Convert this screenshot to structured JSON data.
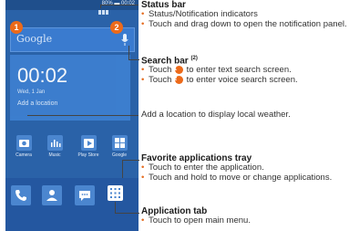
{
  "phone": {
    "status_text": "80% ▬ 00:02",
    "search_logo": "Google",
    "badge_1": "1",
    "badge_2": "2",
    "clock_time": "00:02",
    "clock_date": "Wed, 1 Jan",
    "clock_location": "Add a location",
    "apps": [
      "Camera",
      "Music",
      "Play Store",
      "Google"
    ],
    "tray_icons": [
      "phone-icon",
      "contacts-icon",
      "messaging-icon"
    ]
  },
  "annotations": {
    "status_bar": {
      "heading": "Status bar",
      "bullets": [
        "Status/Notification indicators",
        "Touch and drag down to open the notification panel."
      ]
    },
    "search_bar": {
      "heading": "Search bar",
      "superscript": "(2)",
      "bullet_1_pre": "Touch",
      "bullet_1_post": "to enter text search screen.",
      "bullet_2_pre": "Touch",
      "bullet_2_post": "to enter voice search screen."
    },
    "weather": {
      "text": "Add a location to display local weather."
    },
    "favorites": {
      "heading": "Favorite applications tray",
      "bullets": [
        "Touch to enter the application.",
        "Touch and hold to move or change applications."
      ]
    },
    "app_tab": {
      "heading": "Application tab",
      "bullets": [
        "Touch to open main menu."
      ]
    }
  },
  "colors": {
    "accent_orange": "#ec6a1a",
    "screen_blue": "#2a62a8"
  }
}
